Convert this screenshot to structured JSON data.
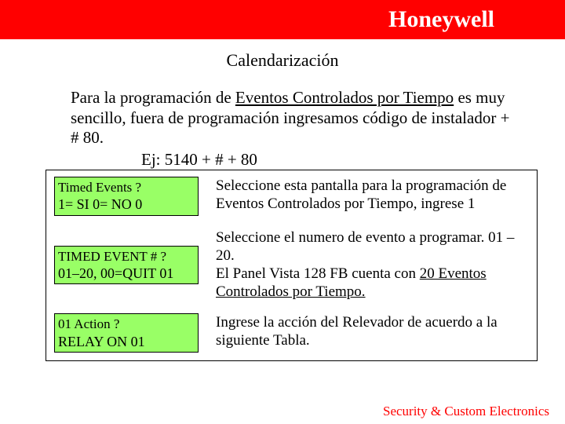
{
  "header": {
    "brand": "Honeywell"
  },
  "title": "Calendarización",
  "intro": {
    "pre": "Para la programación de ",
    "ul": "Eventos Controlados por Tiempo",
    "post": " es muy sencillo, fuera de programación ingresamos código de instalador + # 80.",
    "example": "Ej:  5140 + # + 80"
  },
  "rows": [
    {
      "lcd": {
        "l1": "Timed Events    ?",
        "l2": " 1= SI   0= NO     0"
      },
      "desc": {
        "text": "Seleccione esta pantalla para la programación de Eventos Controlados por Tiempo, ingrese 1"
      }
    },
    {
      "lcd": {
        "l1": "TIMED EVENT # ?",
        "l2": " 01–20, 00=QUIT 01"
      },
      "desc": {
        "pre": "Seleccione el numero de evento a programar. 01 – 20.\nEl Panel Vista 128 FB cuenta con ",
        "ul": "20  Eventos Controlados por Tiempo.",
        "post": ""
      }
    },
    {
      "lcd": {
        "l1": "01   Action        ?",
        "l2": " RELAY ON       01"
      },
      "desc": {
        "text": "Ingrese la acción del Relevador de acuerdo a la siguiente Tabla."
      }
    }
  ],
  "footer": "Security & Custom Electronics"
}
